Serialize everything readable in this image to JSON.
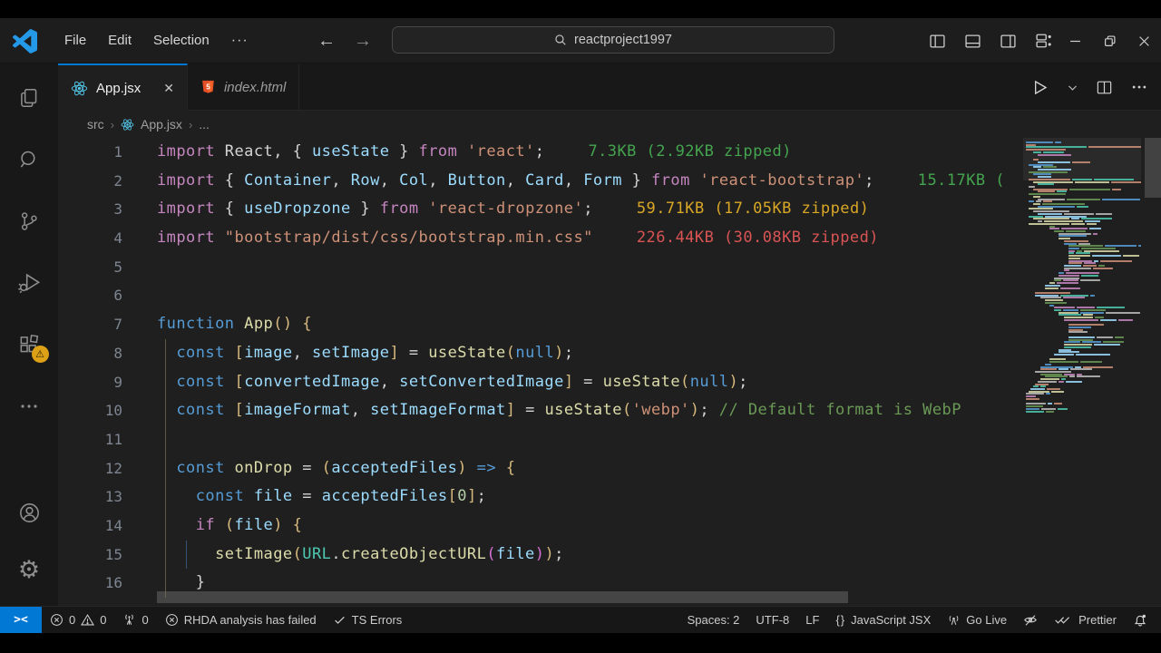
{
  "titlebar": {
    "menu": [
      "File",
      "Edit",
      "Selection"
    ],
    "more": "···",
    "search_value": "reactproject1997"
  },
  "tabs": [
    {
      "label": "App.jsx"
    },
    {
      "label": "index.html"
    }
  ],
  "tab_close": "✕",
  "breadcrumb": {
    "items": [
      "src",
      "App.jsx",
      "..."
    ]
  },
  "editor": {
    "lines": [
      {
        "n": 1,
        "guides": [],
        "tokens": [
          [
            "k",
            "import"
          ],
          [
            "p",
            " React, { "
          ],
          [
            "v",
            "useState"
          ],
          [
            "p",
            " } "
          ],
          [
            "k",
            "from"
          ],
          [
            "p",
            " "
          ],
          [
            "s",
            "'react'"
          ],
          [
            "p",
            ";"
          ]
        ],
        "cost": {
          "text": "7.3KB (2.92KB zipped)",
          "lvl": "ok"
        }
      },
      {
        "n": 2,
        "guides": [],
        "tokens": [
          [
            "k",
            "import"
          ],
          [
            "p",
            " { "
          ],
          [
            "v",
            "Container"
          ],
          [
            "p",
            ", "
          ],
          [
            "v",
            "Row"
          ],
          [
            "p",
            ", "
          ],
          [
            "v",
            "Col"
          ],
          [
            "p",
            ", "
          ],
          [
            "v",
            "Button"
          ],
          [
            "p",
            ", "
          ],
          [
            "v",
            "Card"
          ],
          [
            "p",
            ", "
          ],
          [
            "v",
            "Form"
          ],
          [
            "p",
            " } "
          ],
          [
            "k",
            "from"
          ],
          [
            "p",
            " "
          ],
          [
            "s",
            "'react-bootstrap'"
          ],
          [
            "p",
            ";"
          ]
        ],
        "cost": {
          "text": "15.17KB (",
          "lvl": "ok"
        }
      },
      {
        "n": 3,
        "guides": [],
        "tokens": [
          [
            "k",
            "import"
          ],
          [
            "p",
            " { "
          ],
          [
            "v",
            "useDropzone"
          ],
          [
            "p",
            " } "
          ],
          [
            "k",
            "from"
          ],
          [
            "p",
            " "
          ],
          [
            "s",
            "'react-dropzone'"
          ],
          [
            "p",
            ";"
          ]
        ],
        "cost": {
          "text": "59.71KB (17.05KB zipped)",
          "lvl": "warn"
        }
      },
      {
        "n": 4,
        "guides": [],
        "tokens": [
          [
            "k",
            "import"
          ],
          [
            "p",
            " "
          ],
          [
            "s",
            "\"bootstrap/dist/css/bootstrap.min.css\""
          ]
        ],
        "cost": {
          "text": "226.44KB (30.08KB zipped)",
          "lvl": "err"
        }
      },
      {
        "n": 5,
        "guides": [],
        "tokens": []
      },
      {
        "n": 6,
        "guides": [],
        "tokens": []
      },
      {
        "n": 7,
        "guides": [],
        "tokens": [
          [
            "d",
            "function"
          ],
          [
            "p",
            " "
          ],
          [
            "f",
            "App"
          ],
          [
            "b1",
            "()"
          ],
          [
            "p",
            " "
          ],
          [
            "b1",
            "{"
          ]
        ]
      },
      {
        "n": 8,
        "guides": [
          1
        ],
        "tokens": [
          [
            "p",
            "  "
          ],
          [
            "d",
            "const"
          ],
          [
            "p",
            " "
          ],
          [
            "b1",
            "["
          ],
          [
            "v",
            "image"
          ],
          [
            "p",
            ", "
          ],
          [
            "v",
            "setImage"
          ],
          [
            "b1",
            "]"
          ],
          [
            "p",
            " = "
          ],
          [
            "f",
            "useState"
          ],
          [
            "b1",
            "("
          ],
          [
            "d",
            "null"
          ],
          [
            "b1",
            ")"
          ],
          [
            "p",
            ";"
          ]
        ]
      },
      {
        "n": 9,
        "guides": [
          1
        ],
        "tokens": [
          [
            "p",
            "  "
          ],
          [
            "d",
            "const"
          ],
          [
            "p",
            " "
          ],
          [
            "b1",
            "["
          ],
          [
            "v",
            "convertedImage"
          ],
          [
            "p",
            ", "
          ],
          [
            "v",
            "setConvertedImage"
          ],
          [
            "b1",
            "]"
          ],
          [
            "p",
            " = "
          ],
          [
            "f",
            "useState"
          ],
          [
            "b1",
            "("
          ],
          [
            "d",
            "null"
          ],
          [
            "b1",
            ")"
          ],
          [
            "p",
            ";"
          ]
        ]
      },
      {
        "n": 10,
        "guides": [
          1
        ],
        "tokens": [
          [
            "p",
            "  "
          ],
          [
            "d",
            "const"
          ],
          [
            "p",
            " "
          ],
          [
            "b1",
            "["
          ],
          [
            "v",
            "imageFormat"
          ],
          [
            "p",
            ", "
          ],
          [
            "v",
            "setImageFormat"
          ],
          [
            "b1",
            "]"
          ],
          [
            "p",
            " = "
          ],
          [
            "f",
            "useState"
          ],
          [
            "b1",
            "("
          ],
          [
            "s",
            "'webp'"
          ],
          [
            "b1",
            ")"
          ],
          [
            "p",
            "; "
          ],
          [
            "m",
            "// Default format is WebP"
          ]
        ]
      },
      {
        "n": 11,
        "guides": [
          1
        ],
        "tokens": []
      },
      {
        "n": 12,
        "guides": [
          1
        ],
        "tokens": [
          [
            "p",
            "  "
          ],
          [
            "d",
            "const"
          ],
          [
            "p",
            " "
          ],
          [
            "f",
            "onDrop"
          ],
          [
            "p",
            " = "
          ],
          [
            "b1",
            "("
          ],
          [
            "v",
            "acceptedFiles"
          ],
          [
            "b1",
            ")"
          ],
          [
            "p",
            " "
          ],
          [
            "d",
            "=>"
          ],
          [
            "p",
            " "
          ],
          [
            "b1",
            "{"
          ]
        ]
      },
      {
        "n": 13,
        "guides": [
          1
        ],
        "tokens": [
          [
            "p",
            "    "
          ],
          [
            "d",
            "const"
          ],
          [
            "p",
            " "
          ],
          [
            "v",
            "file"
          ],
          [
            "p",
            " = "
          ],
          [
            "v",
            "acceptedFiles"
          ],
          [
            "b1",
            "["
          ],
          [
            "n",
            "0"
          ],
          [
            "b1",
            "]"
          ],
          [
            "p",
            ";"
          ]
        ]
      },
      {
        "n": 14,
        "guides": [
          1
        ],
        "tokens": [
          [
            "p",
            "    "
          ],
          [
            "k",
            "if"
          ],
          [
            "p",
            " "
          ],
          [
            "b1",
            "("
          ],
          [
            "v",
            "file"
          ],
          [
            "b1",
            ")"
          ],
          [
            "p",
            " "
          ],
          [
            "b1",
            "{"
          ]
        ]
      },
      {
        "n": 15,
        "guides": [
          1,
          3
        ],
        "tokens": [
          [
            "p",
            "      "
          ],
          [
            "f",
            "setImage"
          ],
          [
            "b1",
            "("
          ],
          [
            "c",
            "URL"
          ],
          [
            "p",
            "."
          ],
          [
            "f",
            "createObjectURL"
          ],
          [
            "b2",
            "("
          ],
          [
            "v",
            "file"
          ],
          [
            "b2",
            ")"
          ],
          [
            "b1",
            ")"
          ],
          [
            "p",
            ";"
          ]
        ]
      },
      {
        "n": 16,
        "guides": [
          1
        ],
        "tokens": [
          [
            "p",
            "    }"
          ]
        ]
      }
    ]
  },
  "status": {
    "errors": "0",
    "warnings": "0",
    "ports": "0",
    "rhda": "RHDA analysis has failed",
    "ts": "TS Errors",
    "spaces": "Spaces: 2",
    "encoding": "UTF-8",
    "eol": "LF",
    "braces": "{}",
    "language": "JavaScript JSX",
    "golive": "Go Live",
    "prettier": "Prettier"
  },
  "colors": {
    "accent_blue": "#0078d4",
    "cost_ok": "#44a44f",
    "cost_warn": "#d9a726",
    "cost_err": "#d95454",
    "react_icon": "#53c6e8",
    "html_icon": "#e44d26",
    "extensions_badge": "#dda117"
  }
}
